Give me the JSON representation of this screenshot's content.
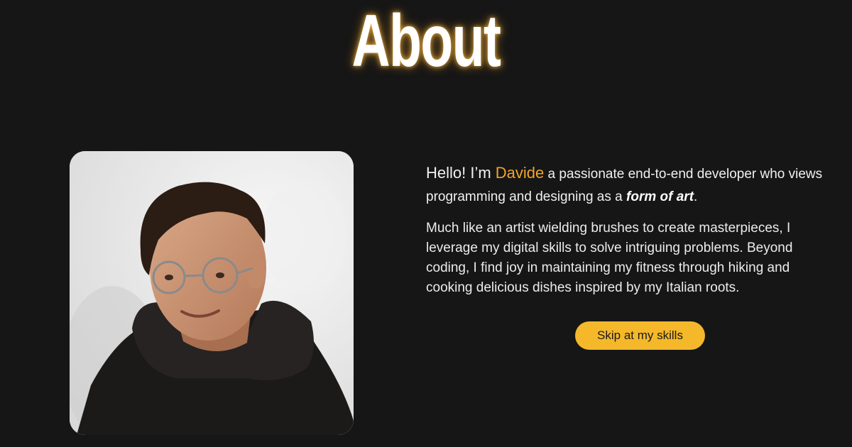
{
  "about": {
    "title": "About",
    "intro": {
      "hello": "Hello! I’m ",
      "name": "Davide",
      "after_name": " a passionate end-to-end developer who views programming and designing as a ",
      "emphasis": "form of art",
      "period": "."
    },
    "body": "Much like an artist wielding brushes to create masterpieces, I leverage my digital skills to solve intriguing problems. Beyond coding, I find joy in maintaining my fitness through hiking and cooking delicious dishes inspired by my Italian roots.",
    "cta_label": "Skip at my skills"
  },
  "colors": {
    "background": "#161616",
    "accent_name": "#f0a52a",
    "button": "#f4b82a",
    "title_glow": "#ffb845"
  }
}
